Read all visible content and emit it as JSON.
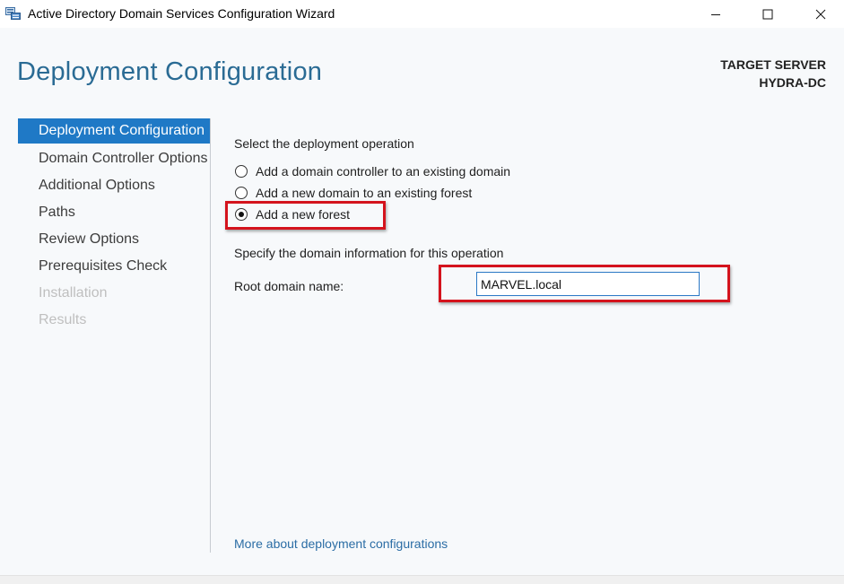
{
  "window": {
    "title": "Active Directory Domain Services Configuration Wizard",
    "icon": "server-icon",
    "controls": [
      "minimize-icon",
      "maximize-icon",
      "close-icon"
    ]
  },
  "header": {
    "page_title": "Deployment Configuration",
    "target_label": "TARGET SERVER",
    "target_name": "HYDRA-DC"
  },
  "nav": {
    "items": [
      {
        "label": "Deployment Configuration",
        "state": "active"
      },
      {
        "label": "Domain Controller Options",
        "state": "normal"
      },
      {
        "label": "Additional Options",
        "state": "normal"
      },
      {
        "label": "Paths",
        "state": "normal"
      },
      {
        "label": "Review Options",
        "state": "normal"
      },
      {
        "label": "Prerequisites Check",
        "state": "normal"
      },
      {
        "label": "Installation",
        "state": "disabled"
      },
      {
        "label": "Results",
        "state": "disabled"
      }
    ]
  },
  "main": {
    "operation_label": "Select the deployment operation",
    "options": [
      {
        "label": "Add a domain controller to an existing domain",
        "checked": false
      },
      {
        "label": "Add a new domain to an existing forest",
        "checked": false
      },
      {
        "label": "Add a new forest",
        "checked": true
      }
    ],
    "domain_info_label": "Specify the domain information for this operation",
    "root_domain_label": "Root domain name:",
    "root_domain_value": "MARVEL.local",
    "more_link": "More about deployment configurations"
  },
  "colors": {
    "accent": "#1f79c6",
    "title": "#2a6b94",
    "highlight": "#d4131d",
    "link": "#2b6da5"
  }
}
